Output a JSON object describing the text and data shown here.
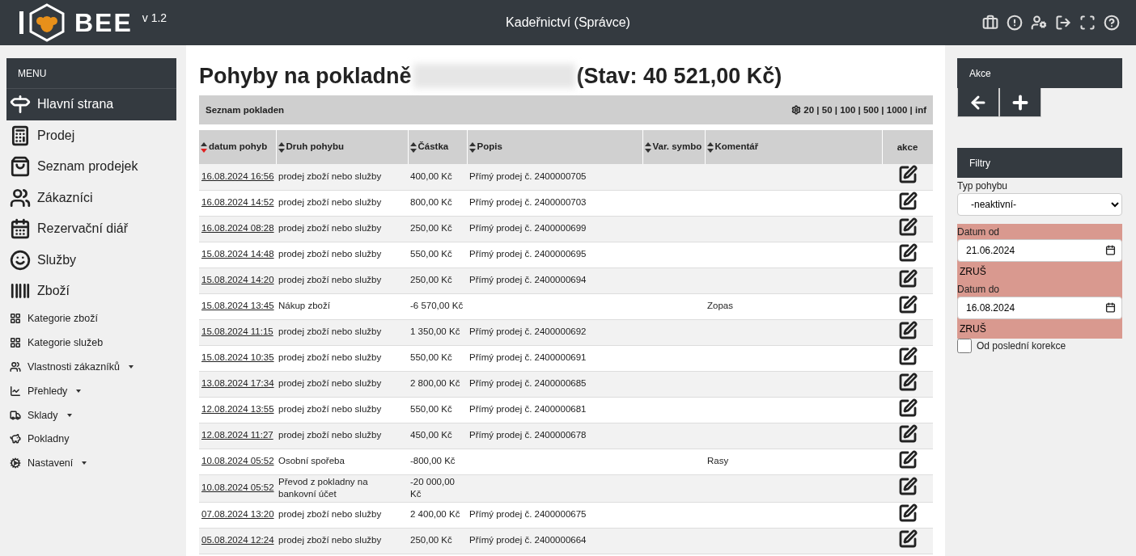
{
  "header": {
    "logo": "BEE",
    "version": "v 1.2",
    "title": "Kadeřnictví (Správce)"
  },
  "menu": {
    "title": "MENU",
    "items": [
      {
        "label": "Hlavní strana",
        "kind": "main",
        "selected": true,
        "dropdown": false
      },
      {
        "label": "Prodej",
        "kind": "main",
        "selected": false,
        "dropdown": false
      },
      {
        "label": "Seznam prodejek",
        "kind": "main",
        "selected": false,
        "dropdown": false
      },
      {
        "label": "Zákazníci",
        "kind": "main",
        "selected": false,
        "dropdown": false
      },
      {
        "label": "Rezervační diář",
        "kind": "main",
        "selected": false,
        "dropdown": false
      },
      {
        "label": "Služby",
        "kind": "main",
        "selected": false,
        "dropdown": false
      },
      {
        "label": "Zboží",
        "kind": "main",
        "selected": false,
        "dropdown": false
      },
      {
        "label": "Kategorie zboží",
        "kind": "sub",
        "selected": false,
        "dropdown": false
      },
      {
        "label": "Kategorie služeb",
        "kind": "sub",
        "selected": false,
        "dropdown": false
      },
      {
        "label": "Vlastnosti zákazníků",
        "kind": "sub",
        "selected": false,
        "dropdown": true
      },
      {
        "label": "Přehledy",
        "kind": "sub",
        "selected": false,
        "dropdown": true
      },
      {
        "label": "Sklady",
        "kind": "sub",
        "selected": false,
        "dropdown": true
      },
      {
        "label": "Pokladny",
        "kind": "sub",
        "selected": false,
        "dropdown": false
      },
      {
        "label": "Nastavení",
        "kind": "sub",
        "selected": false,
        "dropdown": true
      }
    ]
  },
  "page": {
    "title_start": "Pohyby na pokladně",
    "title_end": "(Stav: 40 521,00 Kč)"
  },
  "table": {
    "caption": "Seznam pokladen",
    "page_sizes": "20 | 50 | 100 | 500 | 1000 | inf",
    "columns": [
      {
        "label": "datum pohyb",
        "sortable": true,
        "sorted_desc": true
      },
      {
        "label": "Druh pohybu",
        "sortable": true,
        "sorted_desc": false
      },
      {
        "label": "Částka",
        "sortable": true,
        "sorted_desc": false
      },
      {
        "label": "Popis",
        "sortable": true,
        "sorted_desc": false
      },
      {
        "label": "Var. symbo",
        "sortable": true,
        "sorted_desc": false
      },
      {
        "label": "Komentář",
        "sortable": true,
        "sorted_desc": false
      },
      {
        "label": "akce",
        "sortable": false
      }
    ],
    "rows": [
      {
        "date": "16.08.2024 16:56",
        "type": "prodej zboží nebo služby",
        "amount": "400,00 Kč",
        "description": "Přímý prodej č. 2400000705",
        "comment": ""
      },
      {
        "date": "16.08.2024 14:52",
        "type": "prodej zboží nebo služby",
        "amount": "800,00 Kč",
        "description": "Přímý prodej č. 2400000703",
        "comment": ""
      },
      {
        "date": "16.08.2024 08:28",
        "type": "prodej zboží nebo služby",
        "amount": "250,00 Kč",
        "description": "Přímý prodej č. 2400000699",
        "comment": ""
      },
      {
        "date": "15.08.2024 14:48",
        "type": "prodej zboží nebo služby",
        "amount": "550,00 Kč",
        "description": "Přímý prodej č. 2400000695",
        "comment": ""
      },
      {
        "date": "15.08.2024 14:20",
        "type": "prodej zboží nebo služby",
        "amount": "250,00 Kč",
        "description": "Přímý prodej č. 2400000694",
        "comment": ""
      },
      {
        "date": "15.08.2024 13:45",
        "type": "Nákup zboží",
        "amount": "-6 570,00 Kč",
        "description": "",
        "comment": "Zopas"
      },
      {
        "date": "15.08.2024 11:15",
        "type": "prodej zboží nebo služby",
        "amount": "1 350,00 Kč",
        "description": "Přímý prodej č. 2400000692",
        "comment": ""
      },
      {
        "date": "15.08.2024 10:35",
        "type": "prodej zboží nebo služby",
        "amount": "550,00 Kč",
        "description": "Přímý prodej č. 2400000691",
        "comment": ""
      },
      {
        "date": "13.08.2024 17:34",
        "type": "prodej zboží nebo služby",
        "amount": "2 800,00 Kč",
        "description": "Přímý prodej č. 2400000685",
        "comment": ""
      },
      {
        "date": "12.08.2024 13:55",
        "type": "prodej zboží nebo služby",
        "amount": "550,00 Kč",
        "description": "Přímý prodej č. 2400000681",
        "comment": ""
      },
      {
        "date": "12.08.2024 11:27",
        "type": "prodej zboží nebo služby",
        "amount": "450,00 Kč",
        "description": "Přímý prodej č. 2400000678",
        "comment": ""
      },
      {
        "date": "10.08.2024 05:52",
        "type": "Osobní spořeba",
        "amount": "-800,00 Kč",
        "description": "",
        "comment": "Rasy"
      },
      {
        "date": "10.08.2024 05:52",
        "type": "Převod z pokladny na bankovní účet",
        "amount": "-20 000,00 Kč",
        "description": "",
        "comment": ""
      },
      {
        "date": "07.08.2024 13:20",
        "type": "prodej zboží nebo služby",
        "amount": "2 400,00 Kč",
        "description": "Přímý prodej č. 2400000675",
        "comment": ""
      },
      {
        "date": "05.08.2024 12:24",
        "type": "prodej zboží nebo služby",
        "amount": "250,00 Kč",
        "description": "Přímý prodej č. 2400000664",
        "comment": ""
      }
    ]
  },
  "actions": {
    "title": "Akce"
  },
  "filters": {
    "title": "Filtry",
    "type_label": "Typ pohybu",
    "type_value": "-neaktivní-",
    "dates": [
      {
        "label": "Datum od",
        "value": "21.06.2024",
        "clear": "ZRUŠ",
        "active": true
      },
      {
        "label": "Datum do",
        "value": "16.08.2024",
        "clear": "ZRUŠ",
        "active": true
      }
    ],
    "checkbox": {
      "label": "Od poslední korekce",
      "checked": false
    }
  }
}
